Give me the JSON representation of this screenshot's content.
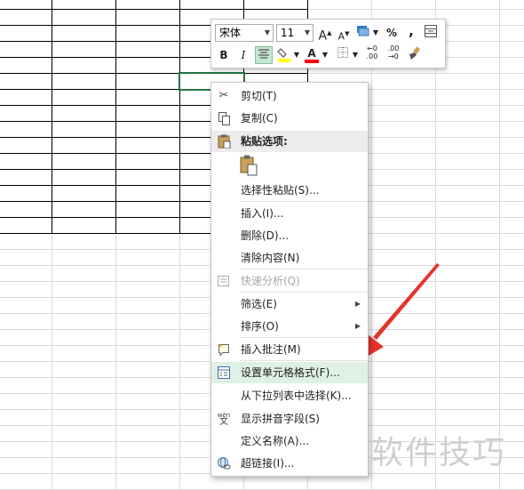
{
  "toolbar": {
    "font_name": "宋体",
    "font_size": "11",
    "grow_font": "A",
    "shrink_font": "A",
    "percent": "%",
    "comma": ",",
    "bold": "B",
    "italic": "I",
    "font_color_letter": "A",
    "dec_increase": "←0 .00",
    "dec_decrease": ".00 →0"
  },
  "context_menu": {
    "cut": "剪切(T)",
    "copy": "复制(C)",
    "paste_options": "粘贴选项:",
    "paste_special": "选择性粘贴(S)...",
    "insert": "插入(I)...",
    "delete": "删除(D)...",
    "clear_contents": "清除内容(N)",
    "quick_analysis": "快速分析(Q)",
    "filter": "筛选(E)",
    "sort": "排序(O)",
    "insert_comment": "插入批注(M)",
    "format_cells": "设置单元格格式(F)...",
    "pick_from_list": "从下拉列表中选择(K)...",
    "phonetic": "显示拼音字段(S)",
    "define_name": "定义名称(A)...",
    "hyperlink": "超链接(I)..."
  },
  "phonetic_glyph": "wén",
  "phonetic_char": "文",
  "watermark": "软件技巧",
  "colors": {
    "accent_green": "#217346",
    "highlight": "#dff1e6",
    "arrow_red": "#e5342b",
    "fill_yellow": "#ffff00",
    "font_red": "#ff0000"
  },
  "icons": [
    "scissors-icon",
    "copy-icon",
    "clipboard-icon",
    "clipboard-paste-icon",
    "quick-analysis-icon",
    "comment-icon",
    "format-cells-icon",
    "phonetic-icon",
    "hyperlink-icon"
  ]
}
